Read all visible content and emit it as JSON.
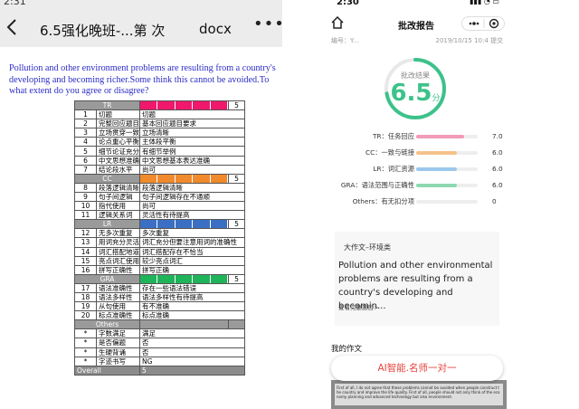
{
  "left": {
    "status_time": "2:31",
    "nav": {
      "title": "6.5强化晚班-...第  次",
      "file_type": "docx",
      "more": "•••"
    },
    "prompt": "Pollution and other environment problems are resulting from a country's developing and becoming richer.Some think this cannot be avoided.To what extent do you agree or disagree?",
    "rubric": {
      "sections": [
        {
          "name": "TR",
          "score": "5",
          "bar_color": "#f0186c",
          "bar_count": 5,
          "rows": [
            {
              "no": "1",
              "item": "切题",
              "desc": "切题"
            },
            {
              "no": "2",
              "item": "完整回应题目",
              "desc": "基本回应题目要求"
            },
            {
              "no": "3",
              "item": "立场贯穿一致",
              "desc": "立场清晰"
            },
            {
              "no": "4",
              "item": "论点重心平衡",
              "desc": "主体段平衡"
            },
            {
              "no": "5",
              "item": "细节论证充分",
              "desc": "有细节举例"
            },
            {
              "no": "6",
              "item": "中文思想准确",
              "desc": "中文思想基本表达准确"
            },
            {
              "no": "7",
              "item": "结论段水平",
              "desc": "尚可"
            }
          ]
        },
        {
          "name": "CC",
          "score": "5",
          "bar_color": "#f08a2c",
          "bar_count": 5,
          "rows": [
            {
              "no": "8",
              "item": "段落逻辑清晰",
              "desc": "段落逻辑清晰"
            },
            {
              "no": "9",
              "item": "句子间逻辑",
              "desc": "句子间逻辑存在不通顺"
            },
            {
              "no": "10",
              "item": "指代使用",
              "desc": "尚可"
            },
            {
              "no": "11",
              "item": "逻辑关系词",
              "desc": "灵活性有待提高"
            }
          ]
        },
        {
          "name": "LR",
          "score": "5",
          "bar_color": "#3a6fc4",
          "bar_count": 5,
          "rows": [
            {
              "no": "12",
              "item": "无多次重复",
              "desc": "多次重复"
            },
            {
              "no": "13",
              "item": "用词充分灵活",
              "desc": "词汇充分但要注意用词的准确性"
            },
            {
              "no": "14",
              "item": "词汇搭配地道",
              "desc": "词汇搭配存在不恰当"
            },
            {
              "no": "15",
              "item": "亮点词汇使用",
              "desc": "较少亮点词汇"
            },
            {
              "no": "16",
              "item": "拼写正确性",
              "desc": "拼写正确"
            }
          ]
        },
        {
          "name": "GRA",
          "score": "5",
          "bar_color": "#1fb35a",
          "bar_count": 5,
          "rows": [
            {
              "no": "17",
              "item": "语法准确性",
              "desc": "存在一些语法错误"
            },
            {
              "no": "18",
              "item": "语法多样性",
              "desc": "语法多样性有待提高"
            },
            {
              "no": "19",
              "item": "从句使用",
              "desc": "有不准确"
            },
            {
              "no": "20",
              "item": "标点准确性",
              "desc": "标点准确"
            }
          ]
        },
        {
          "name": "Others",
          "score": "",
          "bar_color": "",
          "bar_count": 0,
          "rows": [
            {
              "no": "*",
              "item": "字数满足",
              "desc": "满足"
            },
            {
              "no": "*",
              "item": "是否偏题",
              "desc": "否"
            },
            {
              "no": "*",
              "item": "生硬背诵",
              "desc": "否"
            },
            {
              "no": "*",
              "item": "字迹书写",
              "desc": "NG"
            }
          ]
        }
      ],
      "overall_label": "Overall",
      "overall_score": "5"
    }
  },
  "right": {
    "status_time": "2:30",
    "status_icons": "▮▮▮ ◔ ▭",
    "header_title": "批改报告",
    "meta_left": "编号：Y...",
    "meta_right": "2019/10/15 10:4 提交",
    "result_label": "批改结果",
    "score_main": "6.5",
    "score_unit": "分",
    "criteria": [
      {
        "label": "TR：任务回应",
        "value": "7.0",
        "fraction": 0.78,
        "color": "#f29ab8"
      },
      {
        "label": "CC：一致与链接",
        "value": "6.0",
        "fraction": 0.66,
        "color": "#f5c28a"
      },
      {
        "label": "LR：词汇资源",
        "value": "6.0",
        "fraction": 0.66,
        "color": "#9cc8ec"
      },
      {
        "label": "GRA：语法范围与正确性",
        "value": "6.0",
        "fraction": 0.66,
        "color": "#8ed8b0"
      },
      {
        "label": "Others：有无扣分项",
        "value": "0",
        "fraction": 0,
        "color": "#cccccc"
      }
    ],
    "card_tag": "大作文–环境类",
    "card_text": "Pollution and other environmental problems are resulting from a country's developing and becomin...",
    "view_question": "查看完整题目>",
    "my_work_label": "我的作文",
    "cta_label": "AI智能.名师一对一",
    "essay_snippet": "First of all, I do not agree that these problems cannot be avoided when people construct the country and improve the life quality. First of all, people should not only think of the economy planning and advanced technology but also environment."
  }
}
